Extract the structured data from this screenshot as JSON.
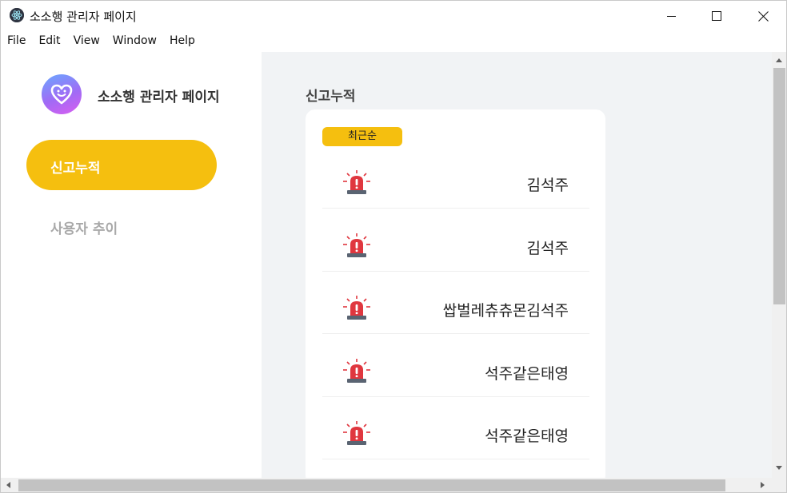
{
  "window": {
    "title": "소소행 관리자 페이지",
    "app_icon": "electron-icon",
    "controls": [
      "minimize-icon",
      "maximize-icon",
      "close-icon"
    ]
  },
  "menu": [
    "File",
    "Edit",
    "View",
    "Window",
    "Help"
  ],
  "sidebar": {
    "brand_name": "소소행 관리자 페이지",
    "logo_icon": "heart-smile-icon",
    "nav": [
      {
        "label": "신고누적",
        "active": true
      },
      {
        "label": "사용자 추이",
        "active": false
      }
    ]
  },
  "main": {
    "section_title": "신고누적",
    "sort_label": "최근순",
    "reports": [
      {
        "name": "김석주",
        "icon": "siren-icon"
      },
      {
        "name": "김석주",
        "icon": "siren-icon"
      },
      {
        "name": "쌉벌레츄츄몬김석주",
        "icon": "siren-icon"
      },
      {
        "name": "석주같은태영",
        "icon": "siren-icon"
      },
      {
        "name": "석주같은태영",
        "icon": "siren-icon"
      }
    ]
  },
  "colors": {
    "accent": "#f5bf0f",
    "main_bg": "#f1f3f5",
    "siren_red": "#e0373f",
    "inactive_text": "#a9a9a9"
  }
}
